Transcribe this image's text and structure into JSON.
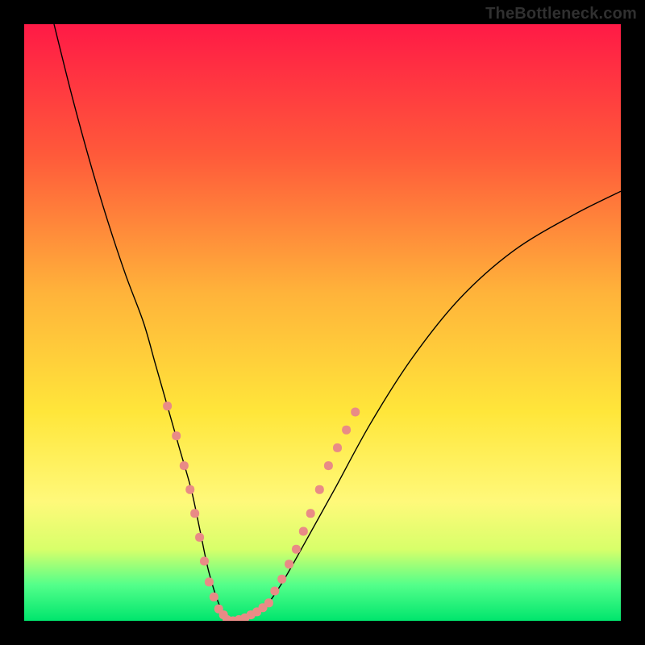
{
  "watermark": "TheBottleneck.com",
  "chart_data": {
    "type": "line",
    "title": "",
    "xlabel": "",
    "ylabel": "",
    "xlim": [
      0,
      100
    ],
    "ylim": [
      0,
      100
    ],
    "gradient_stops": [
      {
        "offset": 0,
        "color": "#ff1a46"
      },
      {
        "offset": 22,
        "color": "#ff5a3a"
      },
      {
        "offset": 45,
        "color": "#ffb33a"
      },
      {
        "offset": 65,
        "color": "#ffe63a"
      },
      {
        "offset": 80,
        "color": "#fff97a"
      },
      {
        "offset": 88,
        "color": "#d8ff6a"
      },
      {
        "offset": 94,
        "color": "#53ff8a"
      },
      {
        "offset": 100,
        "color": "#00e56d"
      }
    ],
    "series": [
      {
        "name": "bottleneck_curve",
        "type": "line",
        "color": "#000000",
        "width": 1.4,
        "x": [
          5,
          8,
          11,
          14,
          17,
          20,
          22,
          24,
          26,
          28,
          29.5,
          31,
          33,
          35,
          37,
          40,
          43,
          47,
          52,
          58,
          65,
          73,
          82,
          92,
          100
        ],
        "y": [
          100,
          88,
          77,
          67,
          58,
          50,
          43,
          36,
          29,
          22,
          15,
          8,
          2,
          0,
          0.5,
          2,
          6,
          13,
          22,
          33,
          44,
          54,
          62,
          68,
          72
        ]
      },
      {
        "name": "markers_left",
        "type": "scatter",
        "color": "#e98b86",
        "size": 11,
        "x": [
          24,
          25.5,
          26.8,
          27.8,
          28.6,
          29.4,
          30.2,
          31,
          31.8,
          32.6,
          33.4
        ],
        "y": [
          36,
          31,
          26,
          22,
          18,
          14,
          10,
          6.5,
          4,
          2,
          1
        ]
      },
      {
        "name": "markers_bottom",
        "type": "scatter",
        "color": "#e98b86",
        "size": 11,
        "x": [
          34,
          35,
          36,
          37,
          38,
          39,
          40,
          41
        ],
        "y": [
          0.2,
          0,
          0.2,
          0.5,
          1,
          1.5,
          2.2,
          3
        ]
      },
      {
        "name": "markers_right",
        "type": "scatter",
        "color": "#e98b86",
        "size": 11,
        "x": [
          42,
          43.2,
          44.4,
          45.6,
          46.8,
          48,
          49.5,
          51,
          52.5,
          54,
          55.5
        ],
        "y": [
          5,
          7,
          9.5,
          12,
          15,
          18,
          22,
          26,
          29,
          32,
          35
        ]
      }
    ]
  }
}
